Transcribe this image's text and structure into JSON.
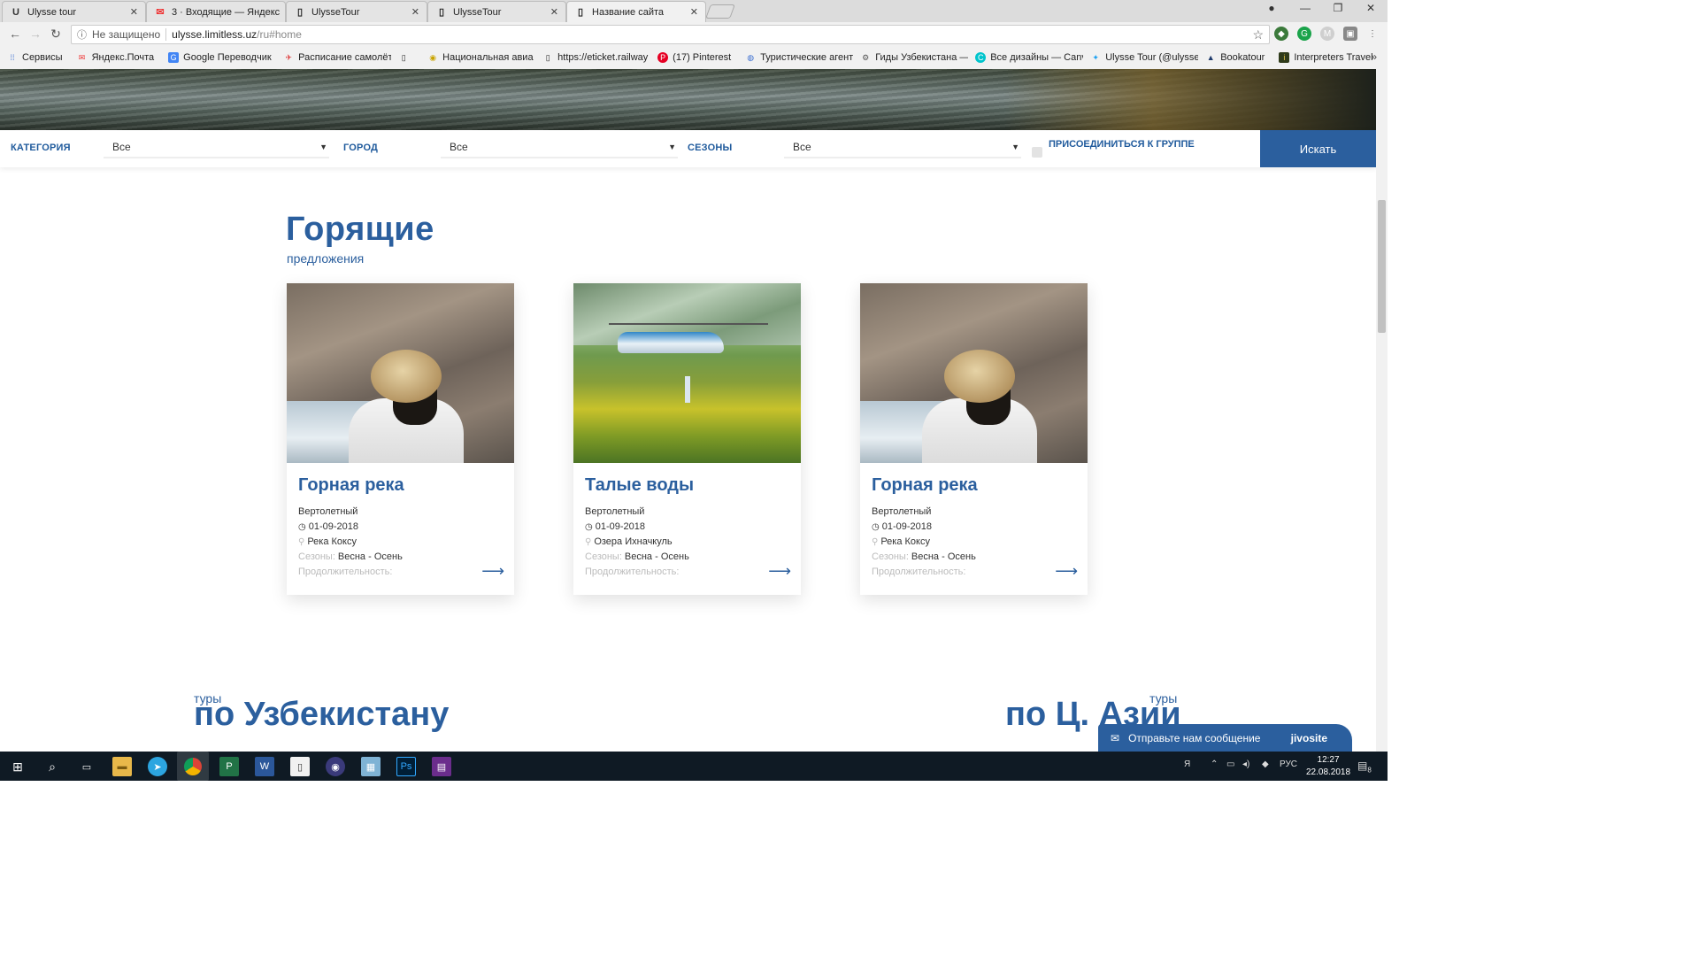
{
  "browser": {
    "tabs": [
      {
        "title": "Ulysse tour",
        "icon": "ulysse-icon"
      },
      {
        "title": "3 · Входящие — Яндекс",
        "icon": "yandex-mail-icon"
      },
      {
        "title": "UlysseTour",
        "icon": "page-icon"
      },
      {
        "title": "UlysseTour",
        "icon": "page-icon"
      },
      {
        "title": "Название сайта",
        "icon": "page-icon"
      }
    ],
    "address": {
      "security": "Не защищено",
      "host": "ulysse.limitless.uz",
      "path": "/ru#home"
    },
    "bookmarks": [
      {
        "label": "Сервисы",
        "icon": "apps-icon"
      },
      {
        "label": "Яндекс.Почта",
        "icon": "yandex-mail-icon"
      },
      {
        "label": "Google Переводчик",
        "icon": "translate-icon"
      },
      {
        "label": "Расписание самолёт",
        "icon": "plane-icon"
      },
      {
        "label": "",
        "icon": "page-icon"
      },
      {
        "label": "Национальная авиа",
        "icon": "airline-icon"
      },
      {
        "label": "https://eticket.railway",
        "icon": "page-icon"
      },
      {
        "label": "(17) Pinterest",
        "icon": "pinterest-icon"
      },
      {
        "label": "Туристические агент",
        "icon": "globe-icon"
      },
      {
        "label": "Гиды Узбекистана —",
        "icon": "gear-icon"
      },
      {
        "label": "Все дизайны — Canv",
        "icon": "canva-icon"
      },
      {
        "label": "Ulysse Tour (@ulysse",
        "icon": "twitter-icon"
      },
      {
        "label": "Bookatour",
        "icon": "bookatour-icon"
      },
      {
        "label": "Interpreters Travel",
        "icon": "interpreters-icon"
      }
    ]
  },
  "filter": {
    "category_label": "КАТЕГОРИЯ",
    "category_value": "Все",
    "city_label": "ГОРОД",
    "city_value": "Все",
    "season_label": "СЕЗОНЫ",
    "season_value": "Все",
    "join_label": "ПРИСОЕДИНИТЬСЯ К ГРУППЕ",
    "search_label": "Искать"
  },
  "hot": {
    "title": "Горящие",
    "subtitle": "предложения",
    "cards": [
      {
        "title": "Горная река",
        "type": "Вертолетный",
        "date": "01-09-2018",
        "place": "Река Коксу",
        "seasons_label": "Сезоны:",
        "seasons": "Весна - Осень",
        "duration_label": "Продолжительность:"
      },
      {
        "title": "Талые воды",
        "type": "Вертолетный",
        "date": "01-09-2018",
        "place": "Озера Ихначкуль",
        "seasons_label": "Сезоны:",
        "seasons": "Весна - Осень",
        "duration_label": "Продолжительность:"
      },
      {
        "title": "Горная река",
        "type": "Вертолетный",
        "date": "01-09-2018",
        "place": "Река Коксу",
        "seasons_label": "Сезоны:",
        "seasons": "Весна - Осень",
        "duration_label": "Продолжительность:"
      }
    ]
  },
  "sections": {
    "uz_small": "туры",
    "uz_big": "по Узбекистану",
    "ca_small": "туры",
    "ca_big": "по Ц. Азии"
  },
  "chat": {
    "text": "Отправьте нам сообщение",
    "brand": "jivosite"
  },
  "taskbar": {
    "lang": "РУС",
    "time": "12:27",
    "date": "22.08.2018",
    "notifications": "8"
  },
  "colors": {
    "brand_blue": "#2b5f9e",
    "muted": "#bbbbbb"
  }
}
